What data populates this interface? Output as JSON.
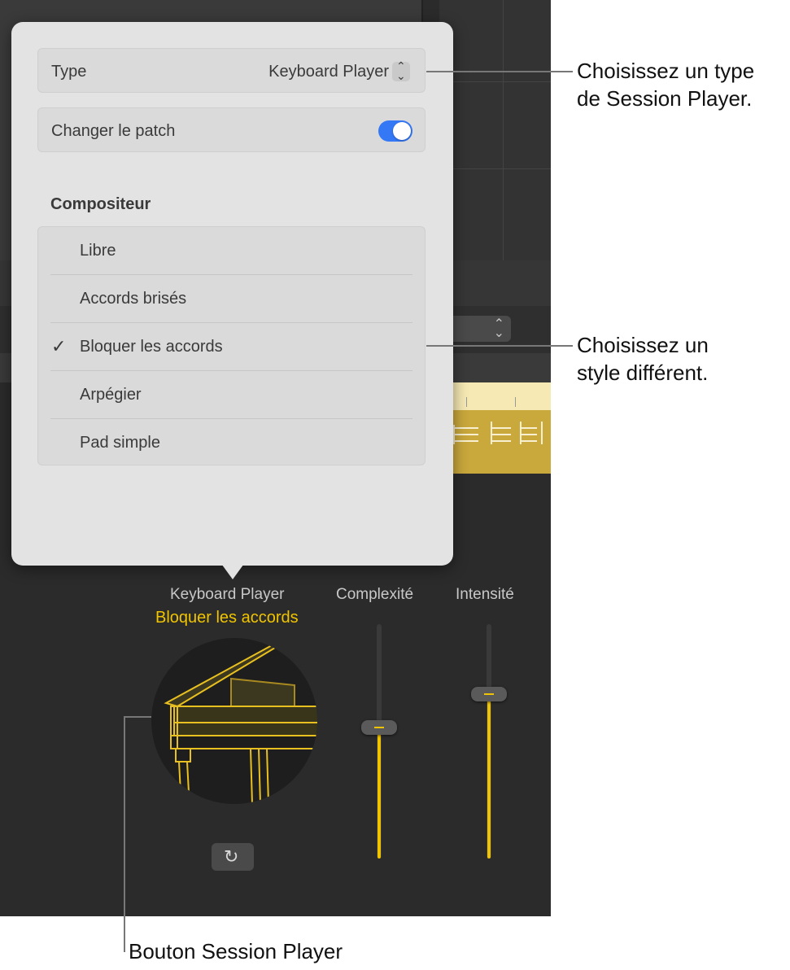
{
  "popover": {
    "type_label": "Type",
    "type_value": "Keyboard Player",
    "patch_label": "Changer le patch",
    "patch_enabled": true,
    "section_title": "Compositeur",
    "styles": [
      {
        "label": "Libre",
        "selected": false
      },
      {
        "label": "Accords brisés",
        "selected": false
      },
      {
        "label": "Bloquer les accords",
        "selected": true
      },
      {
        "label": "Arpégier",
        "selected": false
      },
      {
        "label": "Pad simple",
        "selected": false
      }
    ],
    "check_mark": "✓"
  },
  "player": {
    "name": "Keyboard Player",
    "style": "Bloquer les accords"
  },
  "faders": {
    "complexity_label": "Complexité",
    "intensity_label": "Intensité",
    "complexity_level": 0.56,
    "intensity_level": 0.7
  },
  "callouts": {
    "type": "Choisissez un type\nde Session Player.",
    "style": "Choisissez un\nstyle différent.",
    "button": "Bouton Session Player"
  },
  "colors": {
    "accent": "#f0c400",
    "toggle": "#3478f6"
  }
}
